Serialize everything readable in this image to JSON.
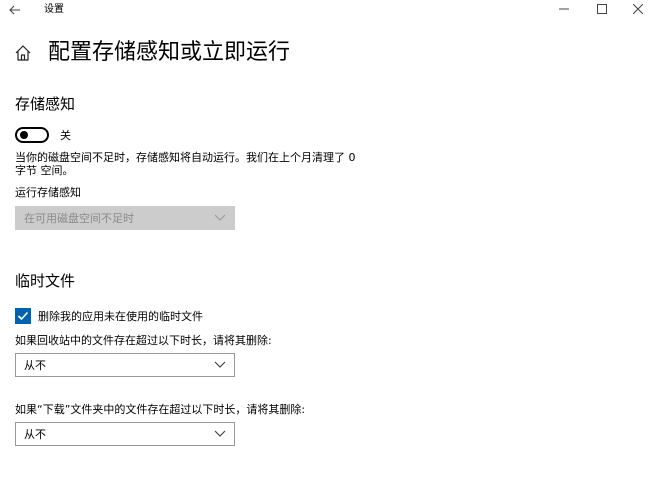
{
  "window": {
    "title": "设置",
    "back_icon": "back-arrow-icon",
    "minimize_icon": "minimize-icon",
    "maximize_icon": "maximize-icon",
    "close_icon": "close-icon"
  },
  "header": {
    "home_icon": "home-icon",
    "title": "配置存储感知或立即运行"
  },
  "storage_sense": {
    "heading": "存储感知",
    "toggle_state": "关",
    "toggle_on": false,
    "description_line1": "当你的磁盘空间不足时，存储感知将自动运行。我们在上个月清理了 0",
    "description_line2": "字节 空间。",
    "run_label": "运行存储感知",
    "run_value": "在可用磁盘空间不足时",
    "run_enabled": false
  },
  "temp_files": {
    "heading": "临时文件",
    "delete_temp_checkbox_label": "删除我的应用未在使用的临时文件",
    "delete_temp_checked": true,
    "recycle_bin_label": "如果回收站中的文件存在超过以下时长，请将其删除:",
    "recycle_bin_value": "从不",
    "downloads_label": "如果“下载”文件夹中的文件存在超过以下时长，请将其删除:",
    "downloads_value": "从不"
  },
  "colors": {
    "accent": "#0063b1",
    "disabled_dropdown": "#cccccc"
  }
}
